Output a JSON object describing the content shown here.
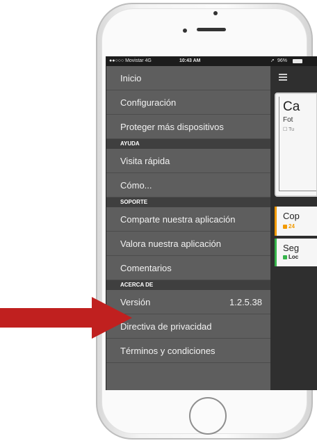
{
  "status_bar": {
    "carrier": "●●○○○ Movistar 4G",
    "time": "10:43 AM",
    "battery": "96%"
  },
  "menu": {
    "items": [
      {
        "kind": "item",
        "label": "Inicio"
      },
      {
        "kind": "item",
        "label": "Configuración"
      },
      {
        "kind": "item",
        "label": "Proteger más dispositivos"
      },
      {
        "kind": "header",
        "label": "AYUDA"
      },
      {
        "kind": "item",
        "label": "Visita rápida"
      },
      {
        "kind": "item",
        "label": "Cómo..."
      },
      {
        "kind": "header",
        "label": "SOPORTE"
      },
      {
        "kind": "item",
        "label": "Comparte nuestra aplicación"
      },
      {
        "kind": "item",
        "label": "Valora nuestra aplicación"
      },
      {
        "kind": "item",
        "label": "Comentarios"
      },
      {
        "kind": "header",
        "label": "ACERCA DE"
      },
      {
        "kind": "item",
        "label": "Versión",
        "value": "1.2.5.38"
      },
      {
        "kind": "item",
        "label": "Directiva de privacidad"
      },
      {
        "kind": "item",
        "label": "Términos y condiciones"
      }
    ]
  },
  "panel": {
    "card1_title": "Ca",
    "card1_sub": "Fot",
    "card1_small": "☐ Tu",
    "card2_title": "Cop",
    "card2_sub": "24",
    "card3_title": "Seg",
    "card3_sub": "Loc"
  },
  "colors": {
    "menu_bg": "#5e5e5e",
    "header_bg": "#3f3f3f",
    "arrow": "#c0201f",
    "orange_accent": "#f29a00",
    "green_accent": "#35b44a"
  },
  "icons": [
    "hamburger-icon",
    "signal-icon",
    "battery-icon",
    "location-icon",
    "arrow-pointer"
  ]
}
